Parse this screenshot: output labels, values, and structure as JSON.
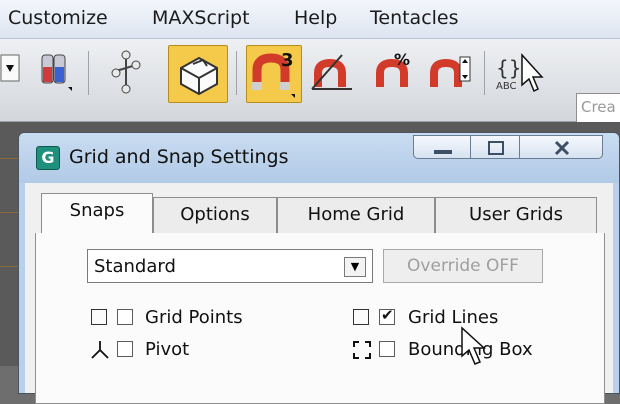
{
  "menubar": {
    "items": [
      "Customize",
      "MAXScript",
      "Help",
      "Tentacles"
    ]
  },
  "toolbar": {
    "search_text": "Crea"
  },
  "dialog": {
    "title": "Grid and Snap Settings",
    "tabs": [
      "Snaps",
      "Options",
      "Home Grid",
      "User Grids"
    ],
    "snap_type": "Standard",
    "override_label": "Override OFF",
    "options": [
      {
        "label": "Grid Points",
        "checked": false
      },
      {
        "label": "Grid Lines",
        "checked": true
      },
      {
        "label": "Pivot",
        "checked": false
      },
      {
        "label": "Bounding Box",
        "checked": false
      }
    ]
  },
  "colors": {
    "active_toolbar_button": "#f5c949",
    "title_bar": "#c9dcf1"
  }
}
